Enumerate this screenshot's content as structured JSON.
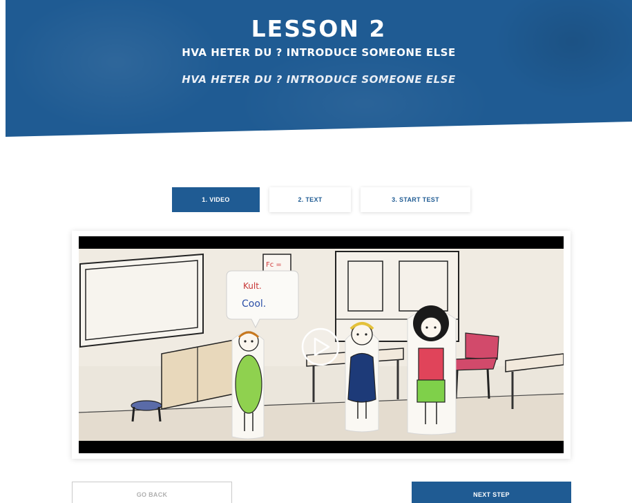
{
  "hero": {
    "title": "LESSON 2",
    "subtitle": "HVA HETER DU ? INTRODUCE SOMEONE ELSE",
    "subtitle_italic": "HVA HETER DU ? INTRODUCE SOMEONE ELSE"
  },
  "tabs": [
    {
      "label": "1. VIDEO",
      "active": true
    },
    {
      "label": "2. TEXT",
      "active": false
    },
    {
      "label": "3. START TEST",
      "active": false
    }
  ],
  "video": {
    "speech_bubble_lines": [
      "Kult.",
      "Cool."
    ],
    "poster_lines": [
      "Fc =",
      "Ø"
    ],
    "play_icon": "play-icon"
  },
  "buttons": {
    "back_label": "GO BACK",
    "next_label": "NEXT STEP"
  },
  "colors": {
    "brand_blue": "#1f5b93",
    "white": "#ffffff"
  }
}
